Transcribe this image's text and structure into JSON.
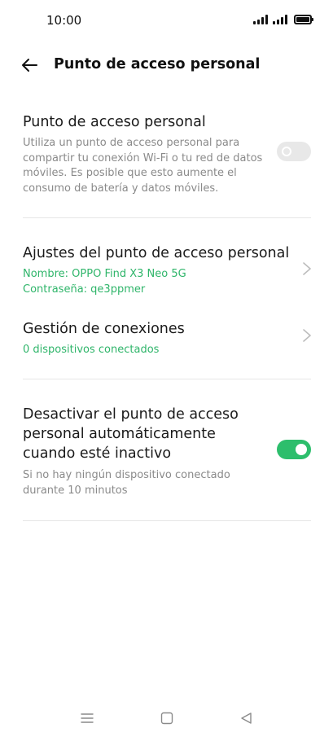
{
  "status_bar": {
    "time": "10:00"
  },
  "header": {
    "title": "Punto de acceso personal",
    "back_icon": "arrow-left-icon"
  },
  "hotspot": {
    "title": "Punto de acceso personal",
    "description": "Utiliza un punto de acceso personal para compartir tu conexión Wi-Fi o tu red de datos móviles. Es posible que esto aumente el consumo de batería y datos móviles.",
    "enabled": false
  },
  "settings": {
    "title": "Ajustes del punto de acceso personal",
    "name_line": "Nombre: OPPO Find X3 Neo 5G",
    "password_line": "Contraseña: qe3ppmer"
  },
  "connections": {
    "title": "Gestión de conexiones",
    "subtitle": "0 dispositivos conectados"
  },
  "auto_off": {
    "title": "Desactivar el punto de acceso personal automáticamente cuando esté inactivo",
    "description": "Si no hay ningún dispositivo conectado durante 10 minutos",
    "enabled": true
  },
  "colors": {
    "accent": "#2fb56a",
    "toggle_on": "#2dbe6c",
    "toggle_off": "#e8e8e8",
    "secondary_text": "#8a8a8a"
  },
  "nav": {
    "icons": [
      "menu-icon",
      "home-icon",
      "back-triangle-icon"
    ]
  }
}
